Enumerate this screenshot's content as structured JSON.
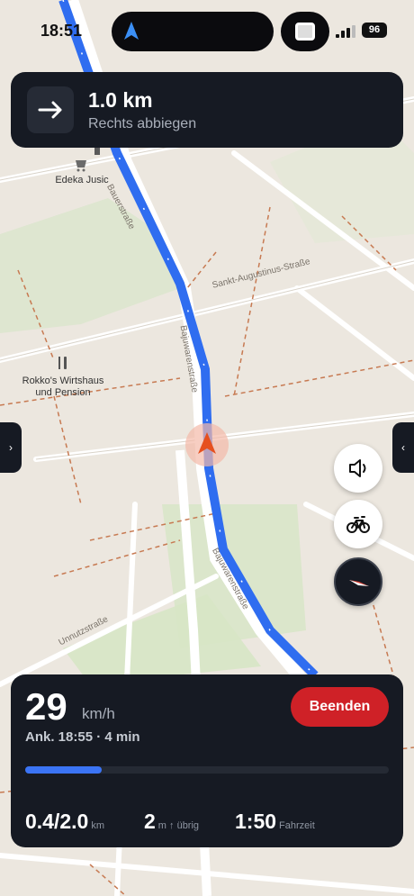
{
  "status_bar": {
    "time": "18:51",
    "battery": "96"
  },
  "navigation": {
    "distance": "1.0 km",
    "instruction": "Rechts abbiegen",
    "maneuver_icon": "arrow-right-icon"
  },
  "map": {
    "pois": [
      {
        "name": "Edeka Jusic",
        "icon": "shopping-cart-icon"
      },
      {
        "name": "Rokko's Wirtshaus und Pension",
        "icon": "restaurant-icon"
      }
    ],
    "streets": [
      "Bauerstraße",
      "Sankt-Augustinus-Straße",
      "Bajuwarenstraße",
      "Bajuwarenstraße",
      "Unnutzstraße"
    ],
    "route_color": "#2f6df0"
  },
  "controls": {
    "sound_icon": "speaker-icon",
    "profile_icon": "bicycle-icon",
    "compass_icon": "compass-icon"
  },
  "trip": {
    "speed": "29",
    "speed_unit": "km/h",
    "eta": "Ank. 18:55 · 4 min",
    "end_label": "Beenden",
    "progress": 0.21,
    "distance_value": "0.4/2.0",
    "distance_unit": "km",
    "elevation_value": "2",
    "elevation_unit": "m ↑ übrig",
    "time_value": "1:50",
    "time_unit": "Fahrzeit"
  }
}
